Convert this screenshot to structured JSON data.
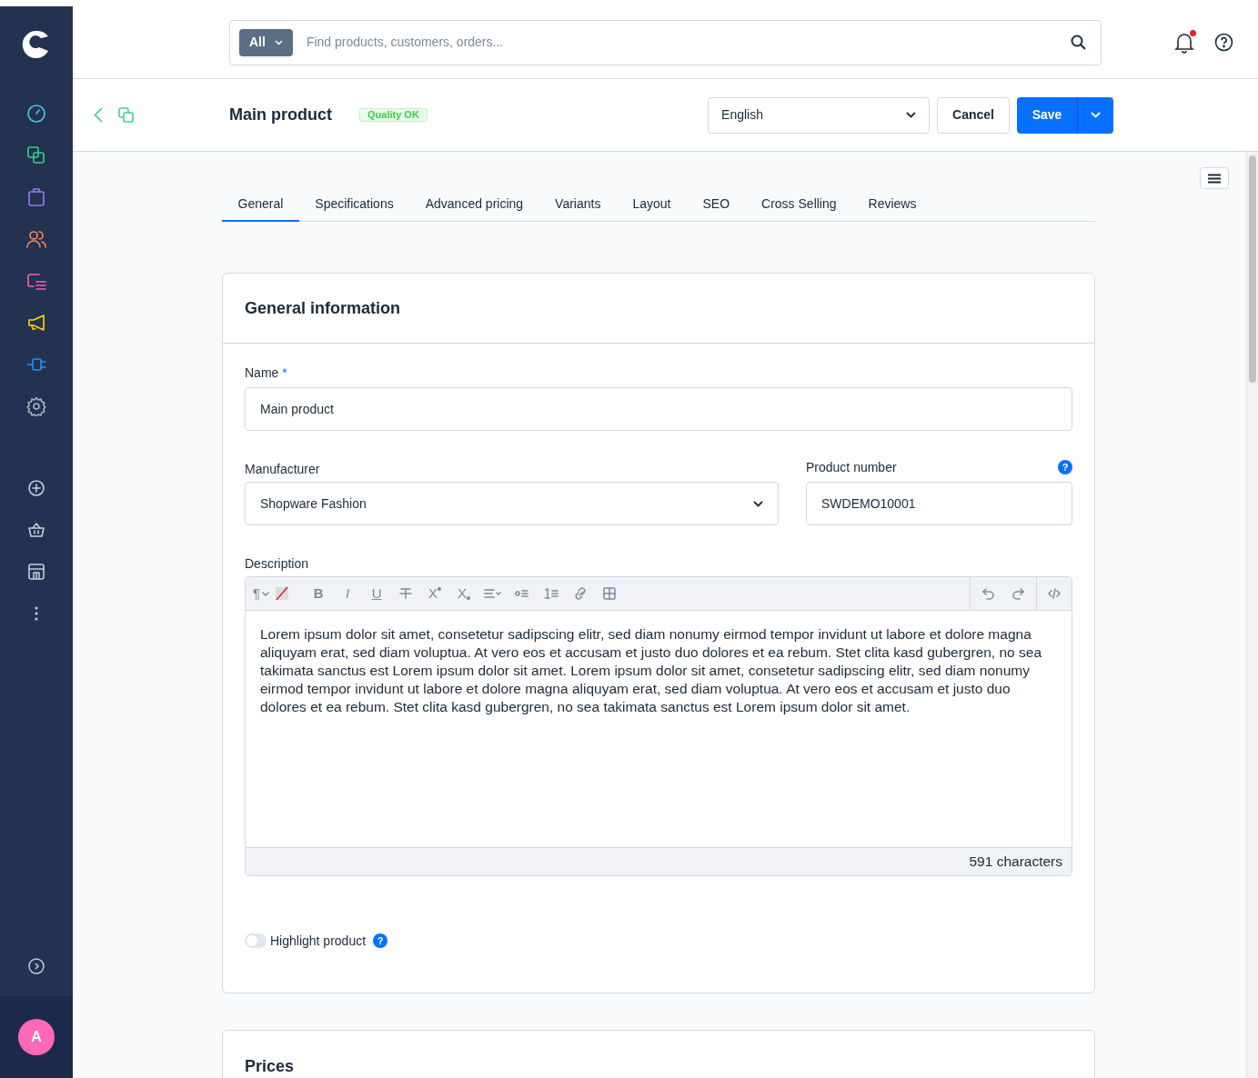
{
  "search": {
    "scope": "All",
    "placeholder": "Find products, customers, orders..."
  },
  "notifications": {
    "unread": true
  },
  "header": {
    "title": "Main product",
    "badge": "Quality OK",
    "language": "English",
    "cancel": "Cancel",
    "save": "Save"
  },
  "tabs": [
    {
      "label": "General",
      "selected": true
    },
    {
      "label": "Specifications",
      "selected": false
    },
    {
      "label": "Advanced pricing",
      "selected": false
    },
    {
      "label": "Variants",
      "selected": false
    },
    {
      "label": "Layout",
      "selected": false
    },
    {
      "label": "SEO",
      "selected": false
    },
    {
      "label": "Cross Selling",
      "selected": false
    },
    {
      "label": "Reviews",
      "selected": false
    }
  ],
  "general_card": {
    "title": "General information",
    "name": {
      "label": "Name",
      "required_mark": "*",
      "value": "Main product"
    },
    "manufacturer": {
      "label": "Manufacturer",
      "value": "Shopware Fashion"
    },
    "product_number": {
      "label": "Product number",
      "help": "?",
      "value": "SWDEMO10001"
    },
    "description": {
      "label": "Description",
      "toolbar": {
        "paragraph": "¶",
        "bold": "B",
        "italic": "I",
        "underline": "U",
        "superscript": "X",
        "subscript": "X"
      },
      "text": "Lorem ipsum dolor sit amet, consetetur sadipscing elitr, sed diam nonumy eirmod tempor invidunt ut labore et dolore magna aliquyam erat, sed diam voluptua. At vero eos et accusam et justo duo dolores et ea rebum. Stet clita kasd gubergren, no sea takimata sanctus est Lorem ipsum dolor sit amet. Lorem ipsum dolor sit amet, consetetur sadipscing elitr, sed diam nonumy eirmod tempor invidunt ut labore et dolore magna aliquyam erat, sed diam voluptua. At vero eos et accusam et justo duo dolores et ea rebum. Stet clita kasd gubergren, no sea takimata sanctus est Lorem ipsum dolor sit amet.",
      "counter": "591 characters"
    },
    "highlight": {
      "label": "Highlight product",
      "on": false,
      "help": "?"
    }
  },
  "prices_card": {
    "title": "Prices"
  },
  "user": {
    "initial": "A"
  }
}
